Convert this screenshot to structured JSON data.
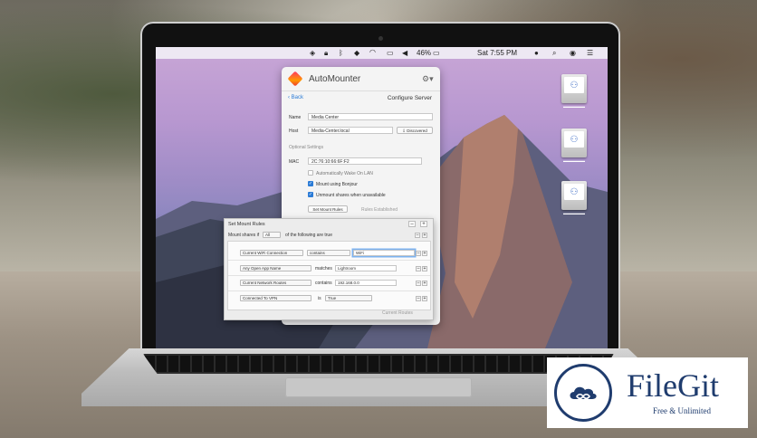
{
  "menubar": {
    "battery": "46%",
    "clock": "Sat 7:55 PM",
    "icons": [
      "dropbox-icon",
      "lock-icon",
      "bluetooth-icon",
      "automounter-icon",
      "wifi-icon",
      "airplay-icon",
      "volume-icon",
      "battery-icon",
      "user-icon",
      "search-icon",
      "siri-icon",
      "menu-icon"
    ]
  },
  "app": {
    "name": "AutoMounter",
    "back_label": "Back",
    "page_title": "Configure Server",
    "name_label": "Name",
    "name_value": "Media Center",
    "host_label": "Host",
    "host_value": "Media-Center.local",
    "discovered_button": "Discovered",
    "optional_settings": "Optional Settings",
    "mac_label": "MAC",
    "mac_value": "2C:76:10:66:6F:F2",
    "wake_on_lan": {
      "label": "Automatically Wake On LAN",
      "checked": false
    },
    "mount_bonjour": {
      "label": "Mount using Bonjour",
      "checked": true
    },
    "unmount_unavailable": {
      "label": "Unmount shares when unavailable",
      "checked": true
    },
    "set_mount_rules_button": "Set Mount Rules",
    "rules_established": "Rules Established"
  },
  "rules": {
    "title": "Set Mount Rules",
    "mount_shares_if": "Mount shares if",
    "quantifier": "All",
    "tail": "of the following are true",
    "items": [
      {
        "field": "Current WiFi Connection",
        "op": "contains",
        "value": "WiFi"
      },
      {
        "field": "Any Open App Name",
        "op": "matches",
        "value": "Lightroom"
      },
      {
        "field": "Current Network Routes",
        "op": "contains",
        "value": "192.168.0.0"
      },
      {
        "field": "Connected To VPN",
        "op": "is",
        "value": "True"
      }
    ],
    "current_routes": "Current Routes"
  },
  "watermark": {
    "name": "FileGit",
    "tagline": "Free & Unlimited"
  },
  "colors": {
    "accent": "#2b7bd6",
    "logo": "#1f3c6e"
  }
}
